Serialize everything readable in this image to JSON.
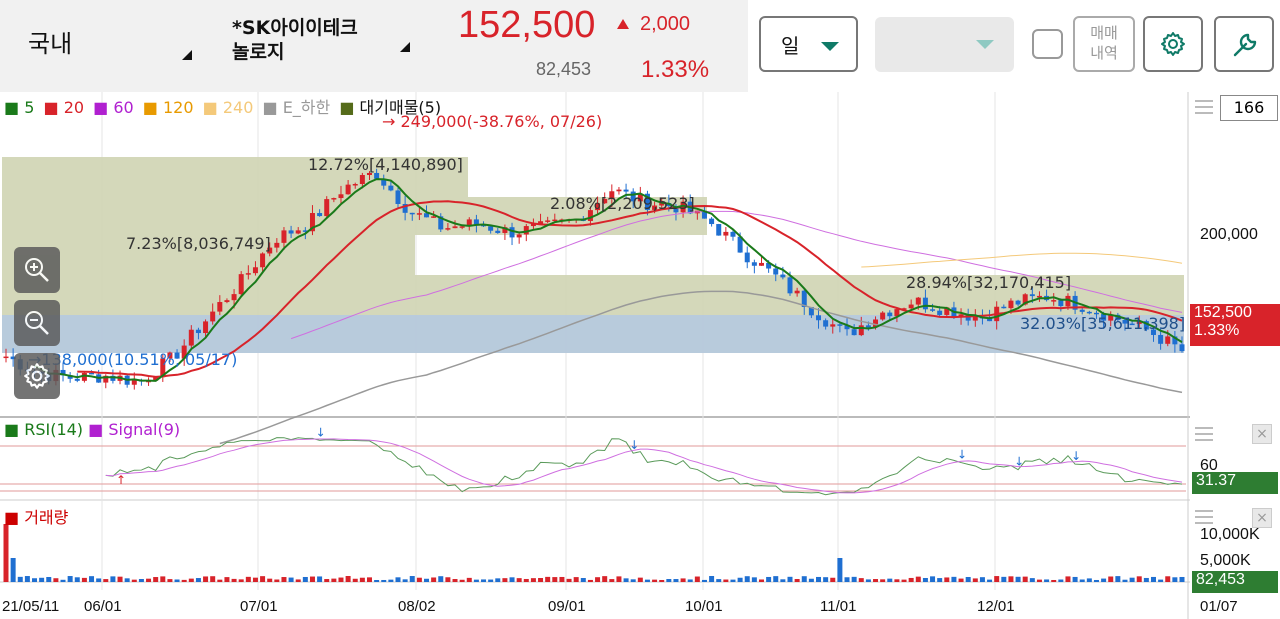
{
  "header": {
    "market": "국내",
    "stock_name_line1": "*SK아이이테크",
    "stock_name_line2": "놀로지",
    "price": "152,500",
    "change": "2,000",
    "volume": "82,453",
    "change_pct": "1.33%",
    "period": "일",
    "trade_history_line1": "매매",
    "trade_history_line2": "내역",
    "colors": {
      "up": "#d8232a",
      "down": "#1f6fd1",
      "accent": "#0f7a67"
    }
  },
  "legend": {
    "items": [
      {
        "label": "5",
        "color": "#1a7a1a"
      },
      {
        "label": "20",
        "color": "#d8232a"
      },
      {
        "label": "60",
        "color": "#b020d0"
      },
      {
        "label": "120",
        "color": "#e89a00"
      },
      {
        "label": "240",
        "color": "#f4c97a"
      },
      {
        "label": "E_하한",
        "color": "#999999"
      },
      {
        "label": "대기매물(5)",
        "color": "#556b1a"
      }
    ]
  },
  "annotations": {
    "high": "249,000(-38.76%, 07/26)",
    "low": "138,000(10.51%, 05/17)",
    "vp1": "12.72%[4,140,890]",
    "vp2": "7.23%[8,036,749]",
    "vp3": "2.08%[2,209,523]",
    "vp4": "28.94%[32,170,415]",
    "vp5": "32.03%[35,611,398]"
  },
  "price_axis": {
    "box_value": "166",
    "tick_200k": "200,000",
    "current_tag": "152,500",
    "current_pct": "1.33%"
  },
  "rsi": {
    "label": "RSI(14)",
    "signal_label": "Signal(9)",
    "tick_60": "60",
    "current": "31.37"
  },
  "volume_panel": {
    "label": "거래량",
    "tick_10k": "10,000K",
    "tick_5k": "5,000K",
    "current": "82,453"
  },
  "x_axis": [
    "21/05/11",
    "06/01",
    "07/01",
    "08/02",
    "09/01",
    "10/01",
    "11/01",
    "12/01",
    "01/07"
  ],
  "chart_data": {
    "type": "candlestick",
    "title": "",
    "x": [
      "05/11",
      "05/18",
      "05/25",
      "06/01",
      "06/08",
      "06/15",
      "06/22",
      "06/29",
      "07/06",
      "07/13",
      "07/20",
      "07/27",
      "08/03",
      "08/10",
      "08/17",
      "08/24",
      "08/31",
      "09/07",
      "09/14",
      "09/21",
      "09/28",
      "10/05",
      "10/12",
      "10/19",
      "10/26",
      "11/02",
      "11/09",
      "11/16",
      "11/23",
      "11/30",
      "12/07",
      "12/14",
      "12/21",
      "12/28",
      "01/04",
      "01/07"
    ],
    "close": [
      150000,
      142000,
      140000,
      141000,
      138000,
      150000,
      168000,
      185000,
      205000,
      212000,
      228000,
      236000,
      218000,
      210000,
      212000,
      208000,
      210000,
      214000,
      228000,
      222000,
      220000,
      212000,
      198000,
      186000,
      172000,
      160000,
      170000,
      176000,
      172000,
      168000,
      175000,
      178000,
      174000,
      168000,
      162000,
      152500
    ],
    "ylim": [
      125000,
      265000
    ],
    "rsi_levels": [
      30,
      70
    ],
    "volume_unit": "K"
  }
}
